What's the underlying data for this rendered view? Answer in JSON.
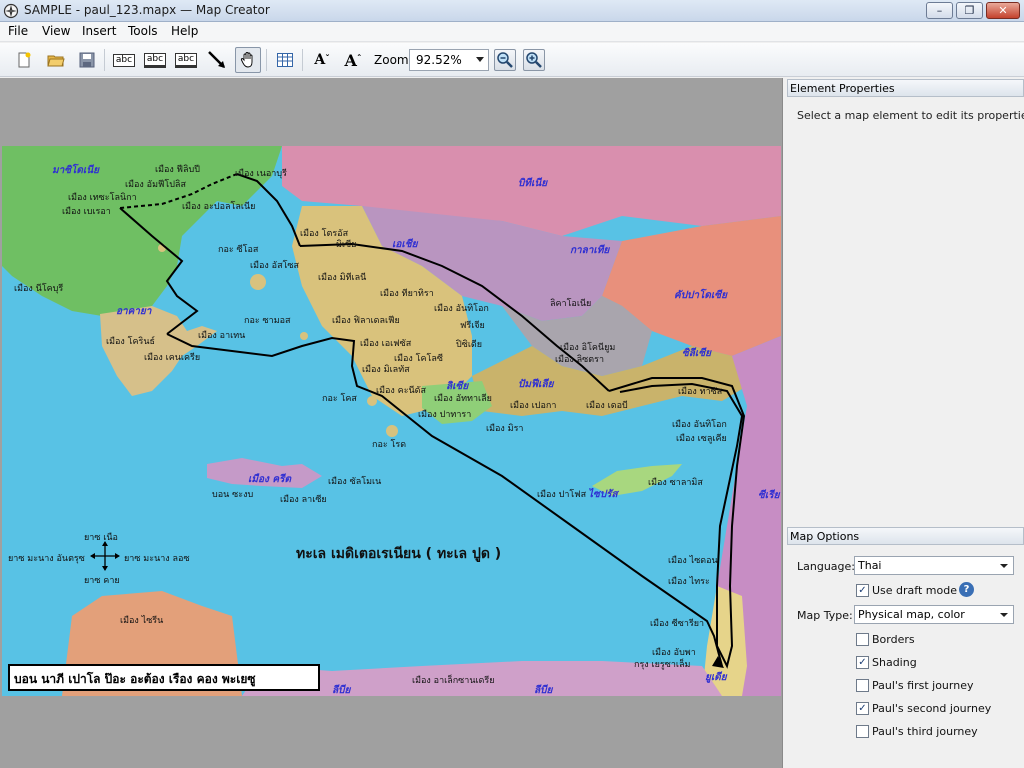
{
  "window": {
    "title": "SAMPLE - paul_123.mapx — Map Creator"
  },
  "menu": [
    "File",
    "View",
    "Insert",
    "Tools",
    "Help"
  ],
  "toolbar": {
    "abc1": "abc",
    "abc2": "abc",
    "abc3": "abc",
    "font_smaller": "A",
    "font_larger": "A",
    "zoom_label": "Zoom:",
    "zoom_value": "92.52%"
  },
  "element_properties": {
    "header": "Element Properties",
    "hint": "Select a map element to edit its properties."
  },
  "map_options": {
    "header": "Map Options",
    "language_label": "Language:",
    "language_value": "Thai",
    "use_draft_mode": {
      "label": "Use draft mode",
      "checked": true
    },
    "map_type_label": "Map Type:",
    "map_type_value": "Physical map, color",
    "layers": [
      {
        "label": "Borders",
        "checked": false
      },
      {
        "label": "Shading",
        "checked": true
      },
      {
        "label": "Paul's first journey",
        "checked": false
      },
      {
        "label": "Paul's second journey",
        "checked": true
      },
      {
        "label": "Paul's third journey",
        "checked": false
      }
    ]
  },
  "map": {
    "title": "บอน นาภี เปาโล ป๊อะ อะต้อง เรือง คอง พะเยซู",
    "sea": "ทะเล เมดิเตอเรเนียน ( ทะเล ปูด )",
    "regions": [
      "มาซิโดเนีย",
      "บิทีเนีย",
      "เอเชีย",
      "กาลาเทีย",
      "คัปปาโดเซีย",
      "อาคายา",
      "ลิเซีย",
      "ปัมฟีเลีย",
      "ซิลีเซีย",
      "ไซปรัส",
      "เมือง ครีต",
      "ซีเรีย",
      "ยูเดีย",
      "ลีบีย",
      "ลีบีย"
    ],
    "places": [
      "เมือง ฟีลิบปี",
      "เมือง เนอาบุรี",
      "เมือง อัมฟีโปลิส",
      "เมือง เทซะโลนิกา",
      "เมือง อะปอลโลเนีย",
      "เมือง เบเรอา",
      "เมือง โตรอัส",
      "มิเซีย",
      "กอะ ซีโอส",
      "เมือง อัสโซส",
      "เมือง มิทีเลนี",
      "เมือง นีโคบุรี",
      "เมือง ทียาทิรา",
      "เมือง อันทิโอก",
      "ลิคาโอเนีย",
      "กอะ ซามอส",
      "เมือง ฟิลาเดลเฟีย",
      "ฟรีเจีย",
      "เมือง โครินธ์",
      "เมือง อาเทน",
      "เมือง เคนเครีย",
      "เมือง เอเฟซัส",
      "ปิซิเดีย",
      "เมือง อิโคนียูม",
      "เมือง ลิซตรา",
      "เมือง โคโลซี",
      "เมือง มิเลทัส",
      "เมือง คะนีดัส",
      "เมือง เดอบี",
      "เมือง ทาซัส",
      "กอะ โคส",
      "เมือง อัททาเลีย",
      "เมือง เปอกา",
      "เมือง ปาทารา",
      "เมือง มิรา",
      "เมือง อันทิโอก",
      "เมือง เซลูเคีย",
      "กอะ โรด",
      "บอน ซะงบ",
      "เมือง ซัลโมเน",
      "เมือง ลาเซีย",
      "เมือง ปาโฟส",
      "เมือง ซาลามิส",
      "เมือง ไซดอน",
      "เมือง ไทระ",
      "เมือง ไซรีน",
      "เมือง ซีซารียา",
      "เมือง อับพา",
      "กรุง เยรูซาเล็ม",
      "เมือง อาเล็กซานเดรีย"
    ],
    "compass": {
      "north": "ยาซ เนือ",
      "south": "ยาซ คาย",
      "west": "ยาซ มะนาง อันตรุซ",
      "east": "ยาซ มะนาง ลอซ"
    }
  },
  "colors": {
    "sea": "#58c2e5",
    "route": "#000000",
    "accent": "#2f2fd2"
  }
}
